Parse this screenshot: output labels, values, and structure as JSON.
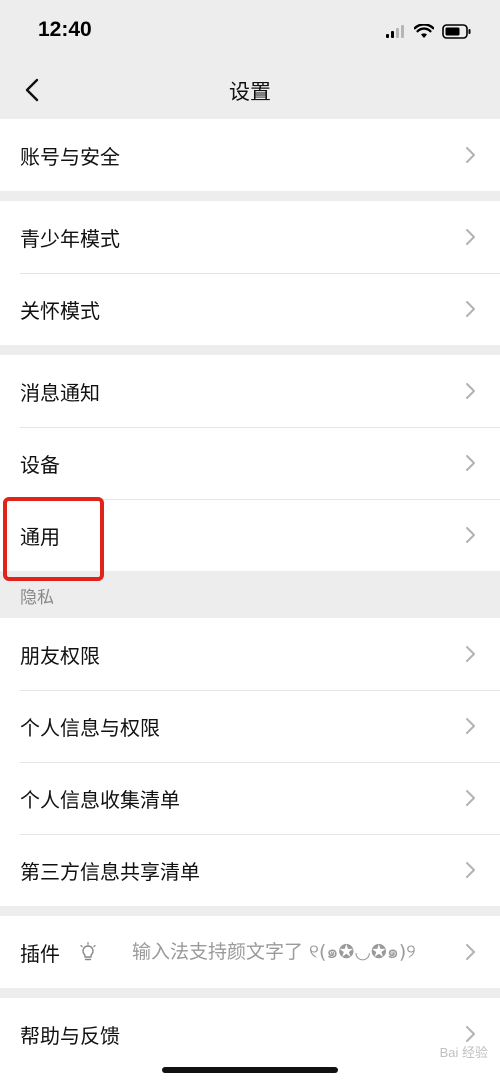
{
  "status_bar": {
    "time": "12:40"
  },
  "nav": {
    "title": "设置"
  },
  "sections": {
    "account": {
      "items": [
        {
          "label": "账号与安全"
        }
      ]
    },
    "modes": {
      "items": [
        {
          "label": "青少年模式"
        },
        {
          "label": "关怀模式"
        }
      ]
    },
    "general": {
      "items": [
        {
          "label": "消息通知"
        },
        {
          "label": "设备"
        },
        {
          "label": "通用"
        }
      ]
    },
    "privacy": {
      "header": "隐私",
      "items": [
        {
          "label": "朋友权限"
        },
        {
          "label": "个人信息与权限"
        },
        {
          "label": "个人信息收集清单"
        },
        {
          "label": "第三方信息共享清单"
        }
      ]
    },
    "plugins": {
      "label": "插件",
      "status": "输入法支持颜文字了 ୧(๑✪◡✪๑)୨",
      "icon": "lightbulb-icon"
    },
    "help": {
      "items": [
        {
          "label": "帮助与反馈"
        }
      ]
    }
  },
  "highlight": {
    "target": "通用",
    "color": "#e0241b"
  },
  "watermark": {
    "text": "Bai 经验"
  }
}
